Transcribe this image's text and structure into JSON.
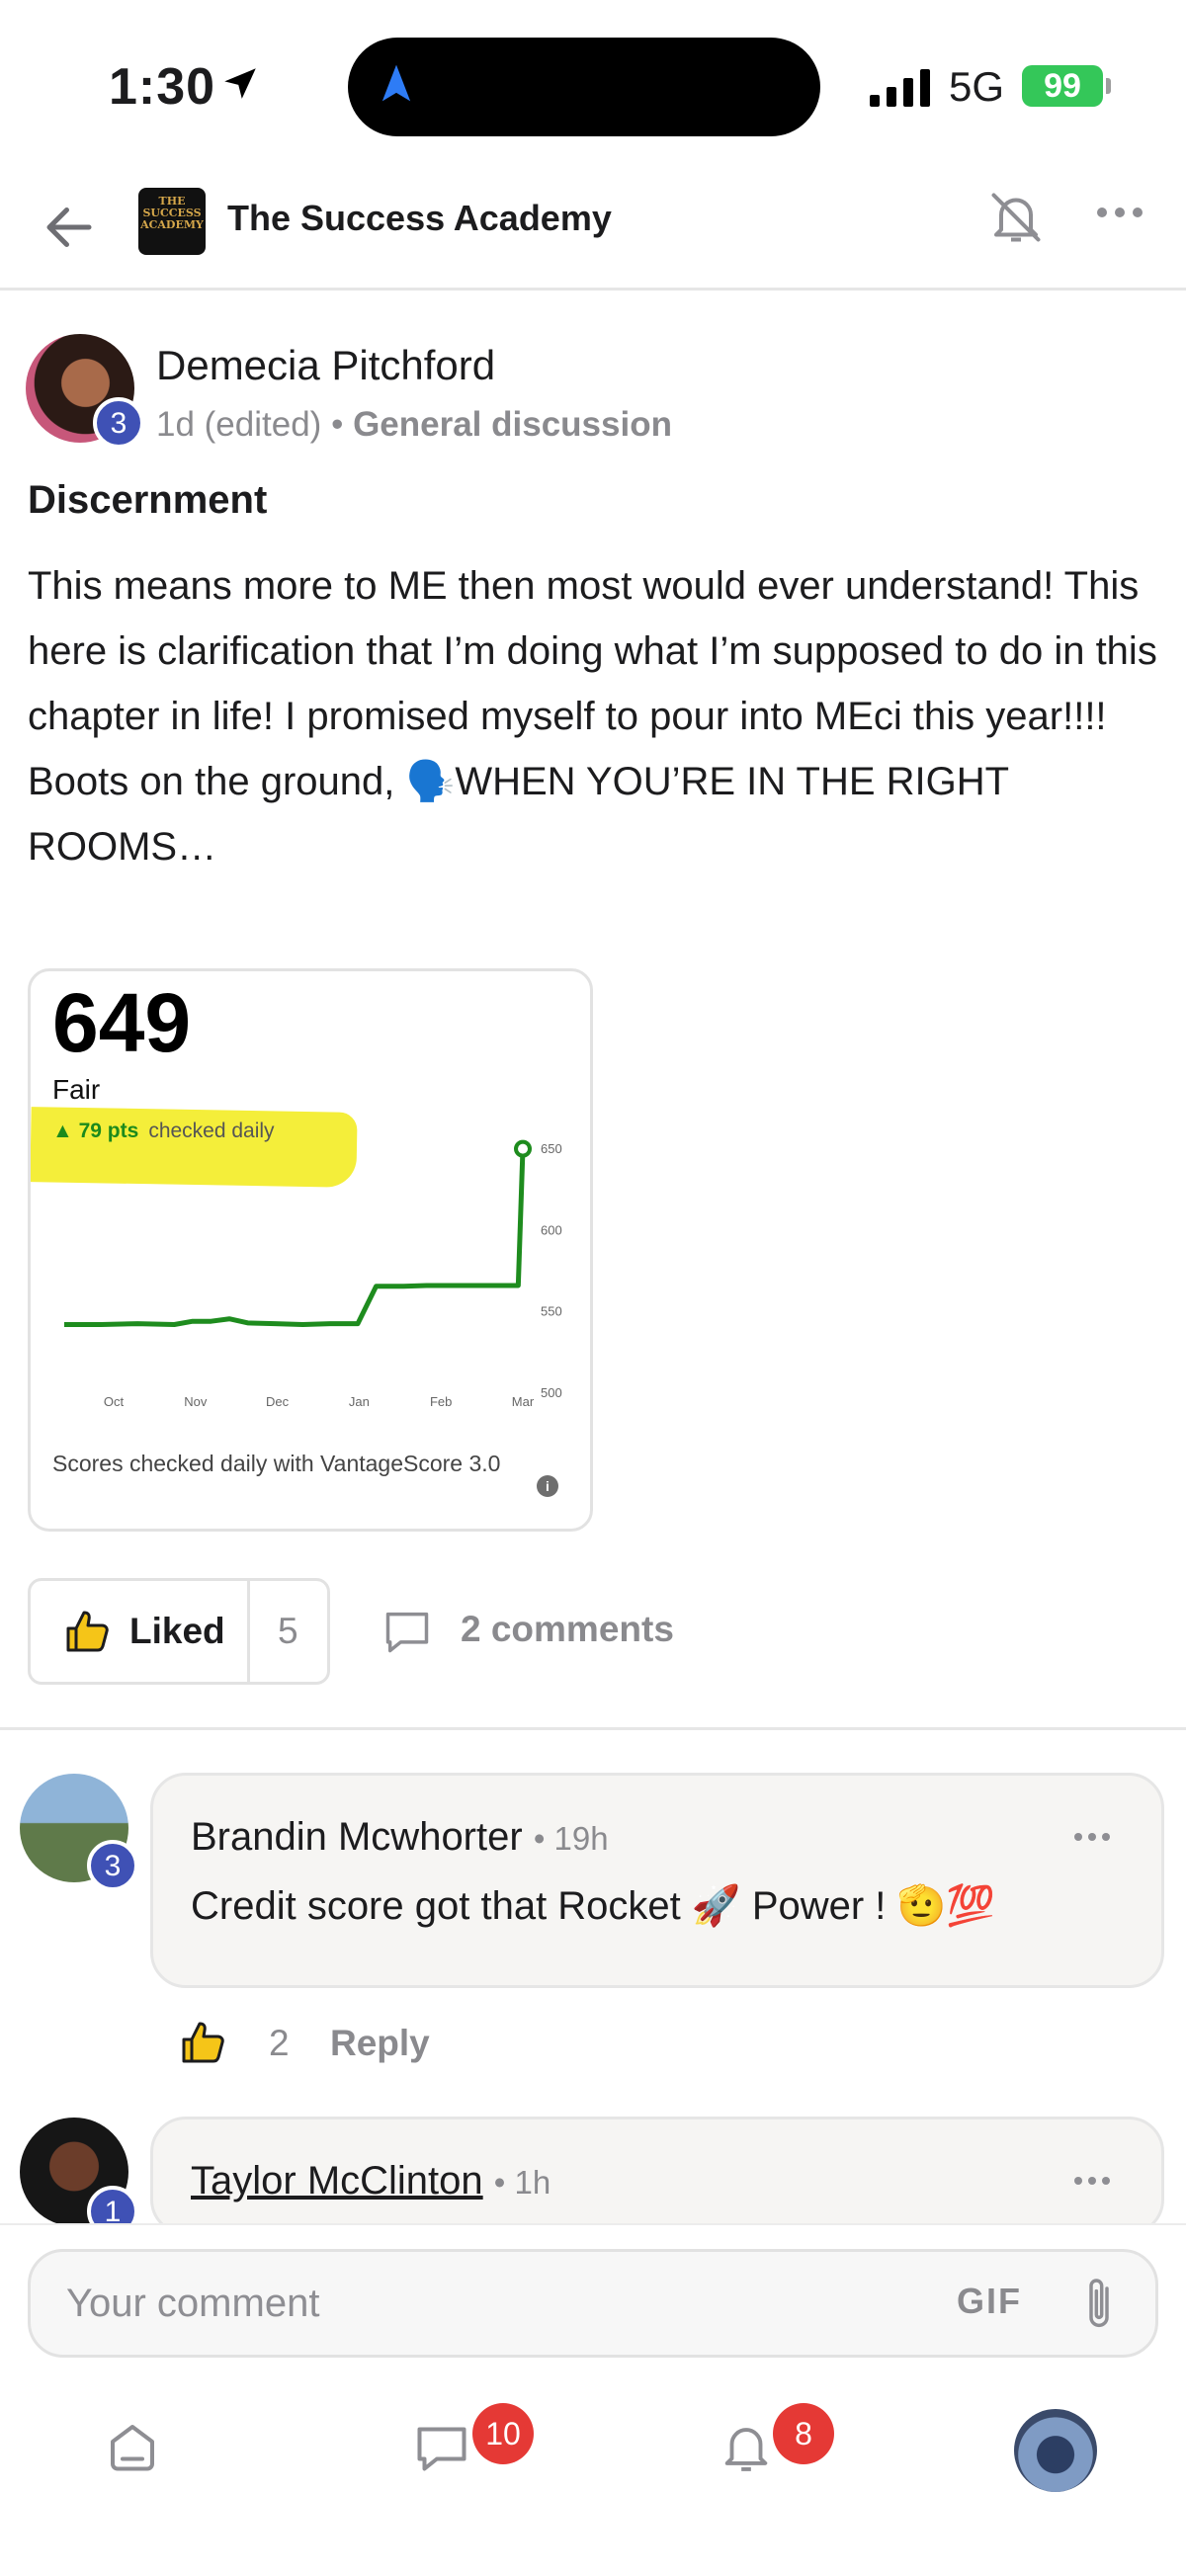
{
  "status_bar": {
    "time": "1:30",
    "network": "5G",
    "battery": "99"
  },
  "header": {
    "group_name": "The Success Academy",
    "logo_text": "THE SUCCESS ACADEMY"
  },
  "post": {
    "author": "Demecia Pitchford",
    "author_level": "3",
    "time": "1d (edited)",
    "separator": "•",
    "category": "General discussion",
    "title": "Discernment",
    "body_main": "This means more to ME then most would ever understand! This here is clarification that I’m doing what I’m supposed to do in this chapter in life! I promised myself to pour into MEci this year!!!! Boots on the ground, ",
    "body_emoji": "🗣️",
    "body_tail": "WHEN YOU’RE IN THE RIGHT ROOMS…",
    "image": {
      "score": "649",
      "rating": "Fair",
      "change": "▲ 79 pts",
      "change_note": "checked daily",
      "footer": "Scores checked daily with VantageScore 3.0",
      "info_icon": "i"
    },
    "like_label": "Liked",
    "like_count": "5",
    "comments_label": "2 comments"
  },
  "chart_data": {
    "type": "line",
    "title": "",
    "x": [
      "Oct",
      "Nov",
      "Dec",
      "Jan",
      "Feb",
      "Mar"
    ],
    "y_ticks": [
      500,
      550,
      600,
      650
    ],
    "ylim": [
      500,
      650
    ],
    "grid": false,
    "series": [
      {
        "values": [
          [
            0.0,
            541
          ],
          [
            0.4,
            541
          ],
          [
            0.8,
            541.5
          ],
          [
            1.2,
            541
          ],
          [
            1.4,
            543
          ],
          [
            1.6,
            543
          ],
          [
            1.8,
            544.5
          ],
          [
            2.0,
            542
          ],
          [
            2.3,
            541.5
          ],
          [
            2.6,
            541
          ],
          [
            2.9,
            541.5
          ],
          [
            3.2,
            541.5
          ],
          [
            3.4,
            564.5
          ],
          [
            3.7,
            564.5
          ],
          [
            3.95,
            565
          ],
          [
            4.3,
            565
          ],
          [
            4.7,
            565
          ],
          [
            4.95,
            565
          ],
          [
            5.0,
            649
          ]
        ]
      }
    ]
  },
  "comments": [
    {
      "name": "Brandin Mcwhorter",
      "time": "19h",
      "level": "3",
      "text": "Credit score got that Rocket 🚀 Power ! 🫡💯",
      "likes": "2",
      "reply": "Reply"
    },
    {
      "name": "Taylor McClinton",
      "time": "1h",
      "level": "1"
    }
  ],
  "comment_bar": {
    "placeholder": "Your comment",
    "gif": "GIF"
  },
  "tabs": {
    "messages_badge": "10",
    "notifications_badge": "8"
  },
  "colors": {
    "accent_green": "#1e8c1e",
    "highlight_yellow": "#f4ee3a",
    "level_badge": "#3f51b5",
    "notification_red": "#e53935",
    "battery_green": "#34c759"
  }
}
